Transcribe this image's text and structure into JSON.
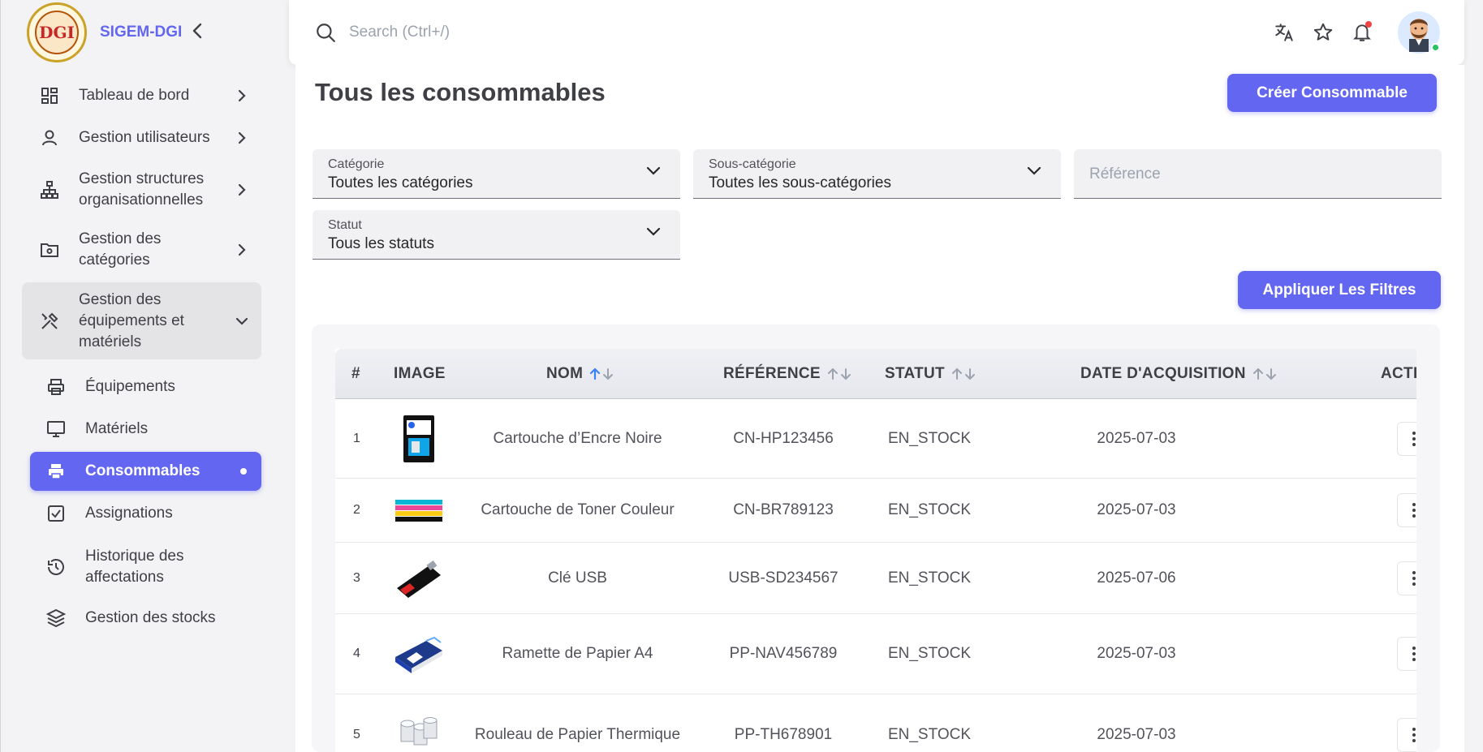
{
  "brand": {
    "logo_text": "DGI",
    "name": "SIGEM-DGI"
  },
  "search": {
    "placeholder": "Search (Ctrl+/)"
  },
  "sidebar": {
    "items": [
      {
        "label": "Tableau de bord",
        "icon": "dashboard-icon"
      },
      {
        "label": "Gestion utilisateurs",
        "icon": "user-icon"
      },
      {
        "label": "Gestion structures organisationnelles",
        "icon": "org-chart-icon"
      },
      {
        "label": "Gestion des catégories",
        "icon": "folder-settings-icon"
      },
      {
        "label": "Gestion des équipements et matériels",
        "icon": "tools-icon"
      }
    ],
    "subitems": [
      {
        "label": "Équipements",
        "icon": "printer-icon"
      },
      {
        "label": "Matériels",
        "icon": "monitor-icon"
      },
      {
        "label": "Consommables",
        "icon": "printer-filled-icon"
      },
      {
        "label": "Assignations",
        "icon": "checkbox-icon"
      },
      {
        "label": "Historique des affectations",
        "icon": "history-icon"
      },
      {
        "label": "Gestion des stocks",
        "icon": "layers-icon"
      }
    ]
  },
  "page": {
    "title": "Tous les consommables",
    "create_label": "Créer Consommable",
    "apply_label": "Appliquer Les Filtres"
  },
  "filters": {
    "categorie": {
      "label": "Catégorie",
      "value": "Toutes les catégories"
    },
    "sous_categorie": {
      "label": "Sous-catégorie",
      "value": "Toutes les sous-catégories"
    },
    "reference": {
      "placeholder": "Référence"
    },
    "statut": {
      "label": "Statut",
      "value": "Tous les statuts"
    }
  },
  "table": {
    "columns": [
      "#",
      "IMAGE",
      "NOM",
      "RÉFÉRENCE",
      "STATUT",
      "DATE D'ACQUISITION",
      "ACTI"
    ],
    "rows": [
      {
        "num": "1",
        "nom": "Cartouche d’Encre Noire",
        "reference": "CN-HP123456",
        "statut": "EN_STOCK",
        "date": "2025-07-03"
      },
      {
        "num": "2",
        "nom": "Cartouche de Toner Couleur",
        "reference": "CN-BR789123",
        "statut": "EN_STOCK",
        "date": "2025-07-03"
      },
      {
        "num": "3",
        "nom": "Clé USB",
        "reference": "USB-SD234567",
        "statut": "EN_STOCK",
        "date": "2025-07-06"
      },
      {
        "num": "4",
        "nom": "Ramette de Papier A4",
        "reference": "PP-NAV456789",
        "statut": "EN_STOCK",
        "date": "2025-07-03"
      },
      {
        "num": "5",
        "nom": "Rouleau de Papier Thermique",
        "reference": "PP-TH678901",
        "statut": "EN_STOCK",
        "date": "2025-07-03"
      }
    ]
  },
  "colors": {
    "accent": "#6366f1",
    "notification": "#ef4444",
    "online": "#22c55e"
  }
}
